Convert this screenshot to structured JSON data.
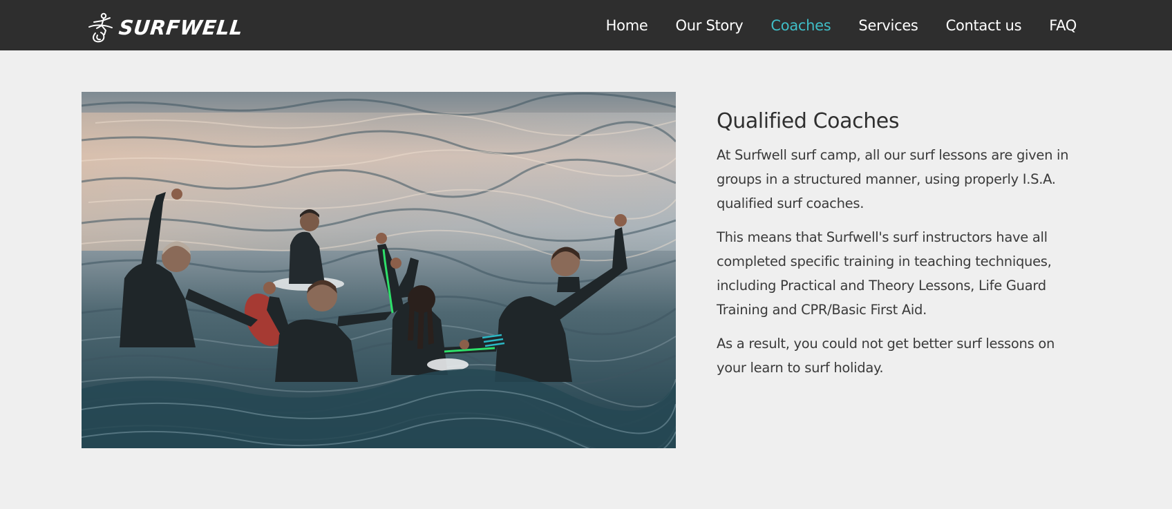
{
  "header": {
    "brand_name": "SURFWELL",
    "logo_icon": "surfer-on-wave-logo",
    "nav_items": [
      {
        "label": "Home",
        "active": false
      },
      {
        "label": "Our Story",
        "active": false
      },
      {
        "label": "Coaches",
        "active": true
      },
      {
        "label": "Services",
        "active": false
      },
      {
        "label": "Contact us",
        "active": false
      },
      {
        "label": "FAQ",
        "active": false
      }
    ]
  },
  "main": {
    "photo_subject": "surfers-in-wetsuits-in-ocean-raising-hands",
    "heading": "Qualified Coaches",
    "paragraphs": [
      "At Surfwell surf camp, all our surf lessons are given in groups in a structured manner, using properly I.S.A. qualified surf coaches.",
      "This means that Surfwell's surf instructors have all completed specific training in teaching techniques, including Practical and Theory Lessons, Life Guard Training and CPR/Basic First Aid.",
      "As a result, you could not get better surf lessons on your learn to surf holiday."
    ]
  },
  "colors": {
    "navbar_bg": "#2e2e2e",
    "page_bg": "#efefef",
    "accent": "#3fbec7",
    "nav_text": "#ffffff",
    "body_text": "#3a3a3a"
  }
}
